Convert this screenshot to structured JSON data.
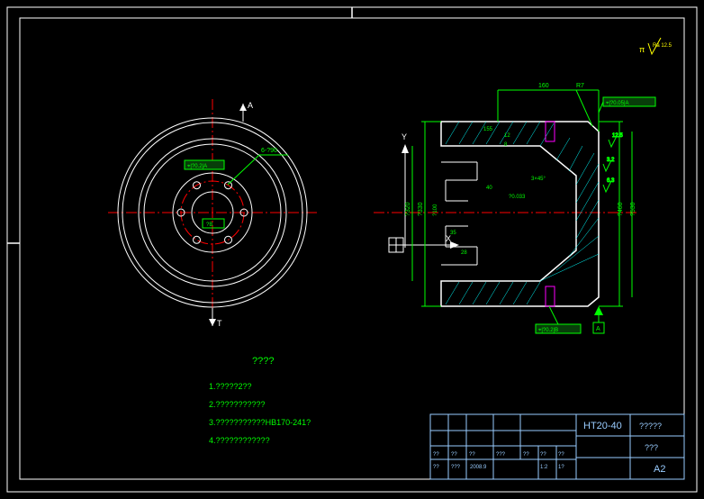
{
  "drawing": {
    "notes_title": "????",
    "notes": {
      "n1": "1.?????2??",
      "n2": "2.???????????",
      "n3": "3.???????????HB170-241?",
      "n4": "4.????????????"
    },
    "front": {
      "angle_label_top": "A",
      "angle_label_bottom": "T",
      "bolt_callout": "6-?90",
      "tol_center_box": "?B",
      "tol_upper_box": "⌖|?0.2|A"
    },
    "axis": {
      "x": "X",
      "y": "Y"
    },
    "section": {
      "dim_top_overall": "160",
      "tol_box_tr": "⌖|?0.05|A",
      "dim_R": "R7",
      "dim_depth1": "12",
      "dim_depth2": "8",
      "dim_h_top": "155",
      "dim_h1": "40",
      "dim_h2": "?0.033",
      "dim_h3": "3.2/",
      "dim_angle_sm": "3×45°",
      "dim_diam_1": "?530",
      "dim_diam_2": "?460",
      "dim_diam_3": "?330",
      "dim_diam_4": "?100",
      "dim_diam_5": "?320",
      "dim_left_small1": "35",
      "dim_left_small2": "28",
      "tol_box_br": "⌖|?0.2|B",
      "datum_A": "A"
    },
    "surface_marks": {
      "top_right": "Ra 12.5",
      "mark1": "3.2",
      "mark2": "12.5",
      "mark3": "6.3"
    }
  },
  "titleblock": {
    "material": "HT20-40",
    "desc": "?????",
    "subdesc": "???",
    "sheet": "A2",
    "row1": {
      "c1": "??",
      "c2": "??",
      "c3": "??",
      "c4": "2008.9",
      "c5": "???",
      "c6": "??",
      "c7": "??",
      "c8": "??",
      "c9": "??"
    },
    "row2": {
      "c1": "??",
      "c2": "???",
      "c3": "",
      "c4": "",
      "c5": "1:2",
      "c6": "",
      "c7": "1?",
      "c8": ""
    }
  }
}
